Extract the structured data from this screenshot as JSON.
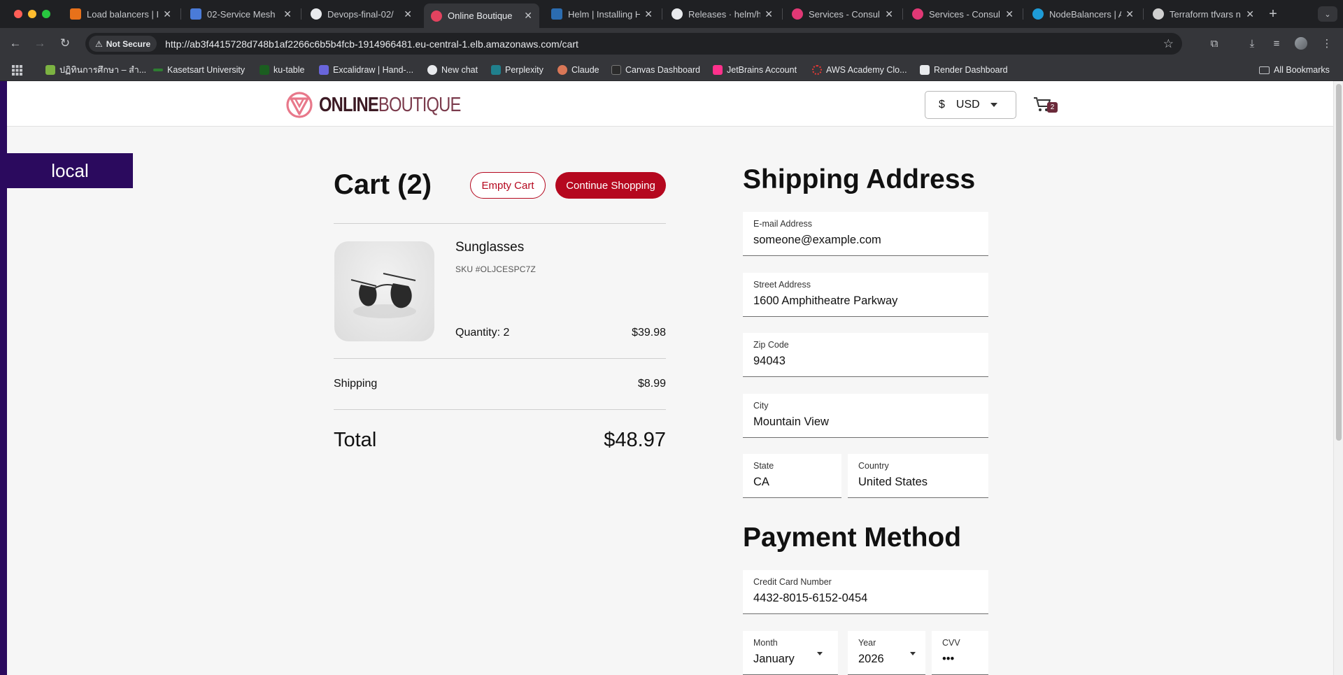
{
  "browser": {
    "tabs": [
      {
        "label": "Load balancers | I",
        "color": "#e8711a"
      },
      {
        "label": "02-Service Mesh",
        "color": "#4a7bd8"
      },
      {
        "label": "Devops-final-02/",
        "color": "#e8eaed"
      },
      {
        "label": "Online Boutique",
        "color": "#e3435f",
        "active": true
      },
      {
        "label": "Helm | Installing H",
        "color": "#2b6cb0"
      },
      {
        "label": "Releases · helm/h",
        "color": "#e8eaed"
      },
      {
        "label": "Services - Consul",
        "color": "#e03875"
      },
      {
        "label": "Services - Consul",
        "color": "#e03875"
      },
      {
        "label": "NodeBalancers | A",
        "color": "#1e9bd7"
      },
      {
        "label": "Terraform tfvars n",
        "color": "#d0d0d0"
      }
    ],
    "security_label": "Not Secure",
    "url": "http://ab3f4415728d748b1af2266c6b5b4fcb-1914966481.eu-central-1.elb.amazonaws.com/cart",
    "bookmarks": [
      {
        "label": "ปฏิทินการศึกษา – สำ...",
        "color": "#7cb342"
      },
      {
        "label": "Kasetsart University",
        "color": "#2e7d32"
      },
      {
        "label": "ku-table",
        "color": "#1b5e20"
      },
      {
        "label": "Excalidraw | Hand-...",
        "color": "#6965db"
      },
      {
        "label": "New chat",
        "color": "#e8eaed"
      },
      {
        "label": "Perplexity",
        "color": "#20808d"
      },
      {
        "label": "Claude",
        "color": "#d97757"
      },
      {
        "label": "Canvas Dashboard",
        "color": "#e8eaed"
      },
      {
        "label": "JetBrains Account",
        "color": "#ff318c"
      },
      {
        "label": "AWS Academy Clo...",
        "color": "#e53935"
      },
      {
        "label": "Render Dashboard",
        "color": "#e8eaed"
      }
    ],
    "all_bookmarks_label": "All Bookmarks"
  },
  "site": {
    "logo_bold": "ONLINE",
    "logo_light": "BOUTIQUE",
    "currency_symbol": "$",
    "currency_code": "USD",
    "cart_count": "2",
    "env_badge": "local",
    "accent_color": "#b5081f"
  },
  "cart": {
    "title": "Cart (2)",
    "empty_button": "Empty Cart",
    "continue_button": "Continue Shopping",
    "item": {
      "name": "Sunglasses",
      "sku": "SKU #OLJCESPC7Z",
      "quantity": "Quantity: 2",
      "price": "$39.98"
    },
    "shipping_label": "Shipping",
    "shipping_value": "$8.99",
    "total_label": "Total",
    "total_value": "$48.97"
  },
  "shipping": {
    "title": "Shipping Address",
    "email_label": "E-mail Address",
    "email_value": "someone@example.com",
    "street_label": "Street Address",
    "street_value": "1600 Amphitheatre Parkway",
    "zip_label": "Zip Code",
    "zip_value": "94043",
    "city_label": "City",
    "city_value": "Mountain View",
    "state_label": "State",
    "state_value": "CA",
    "country_label": "Country",
    "country_value": "United States"
  },
  "payment": {
    "title": "Payment Method",
    "card_label": "Credit Card Number",
    "card_value": "4432-8015-6152-0454",
    "month_label": "Month",
    "month_value": "January",
    "year_label": "Year",
    "year_value": "2026",
    "cvv_label": "CVV",
    "cvv_value": "•••"
  }
}
